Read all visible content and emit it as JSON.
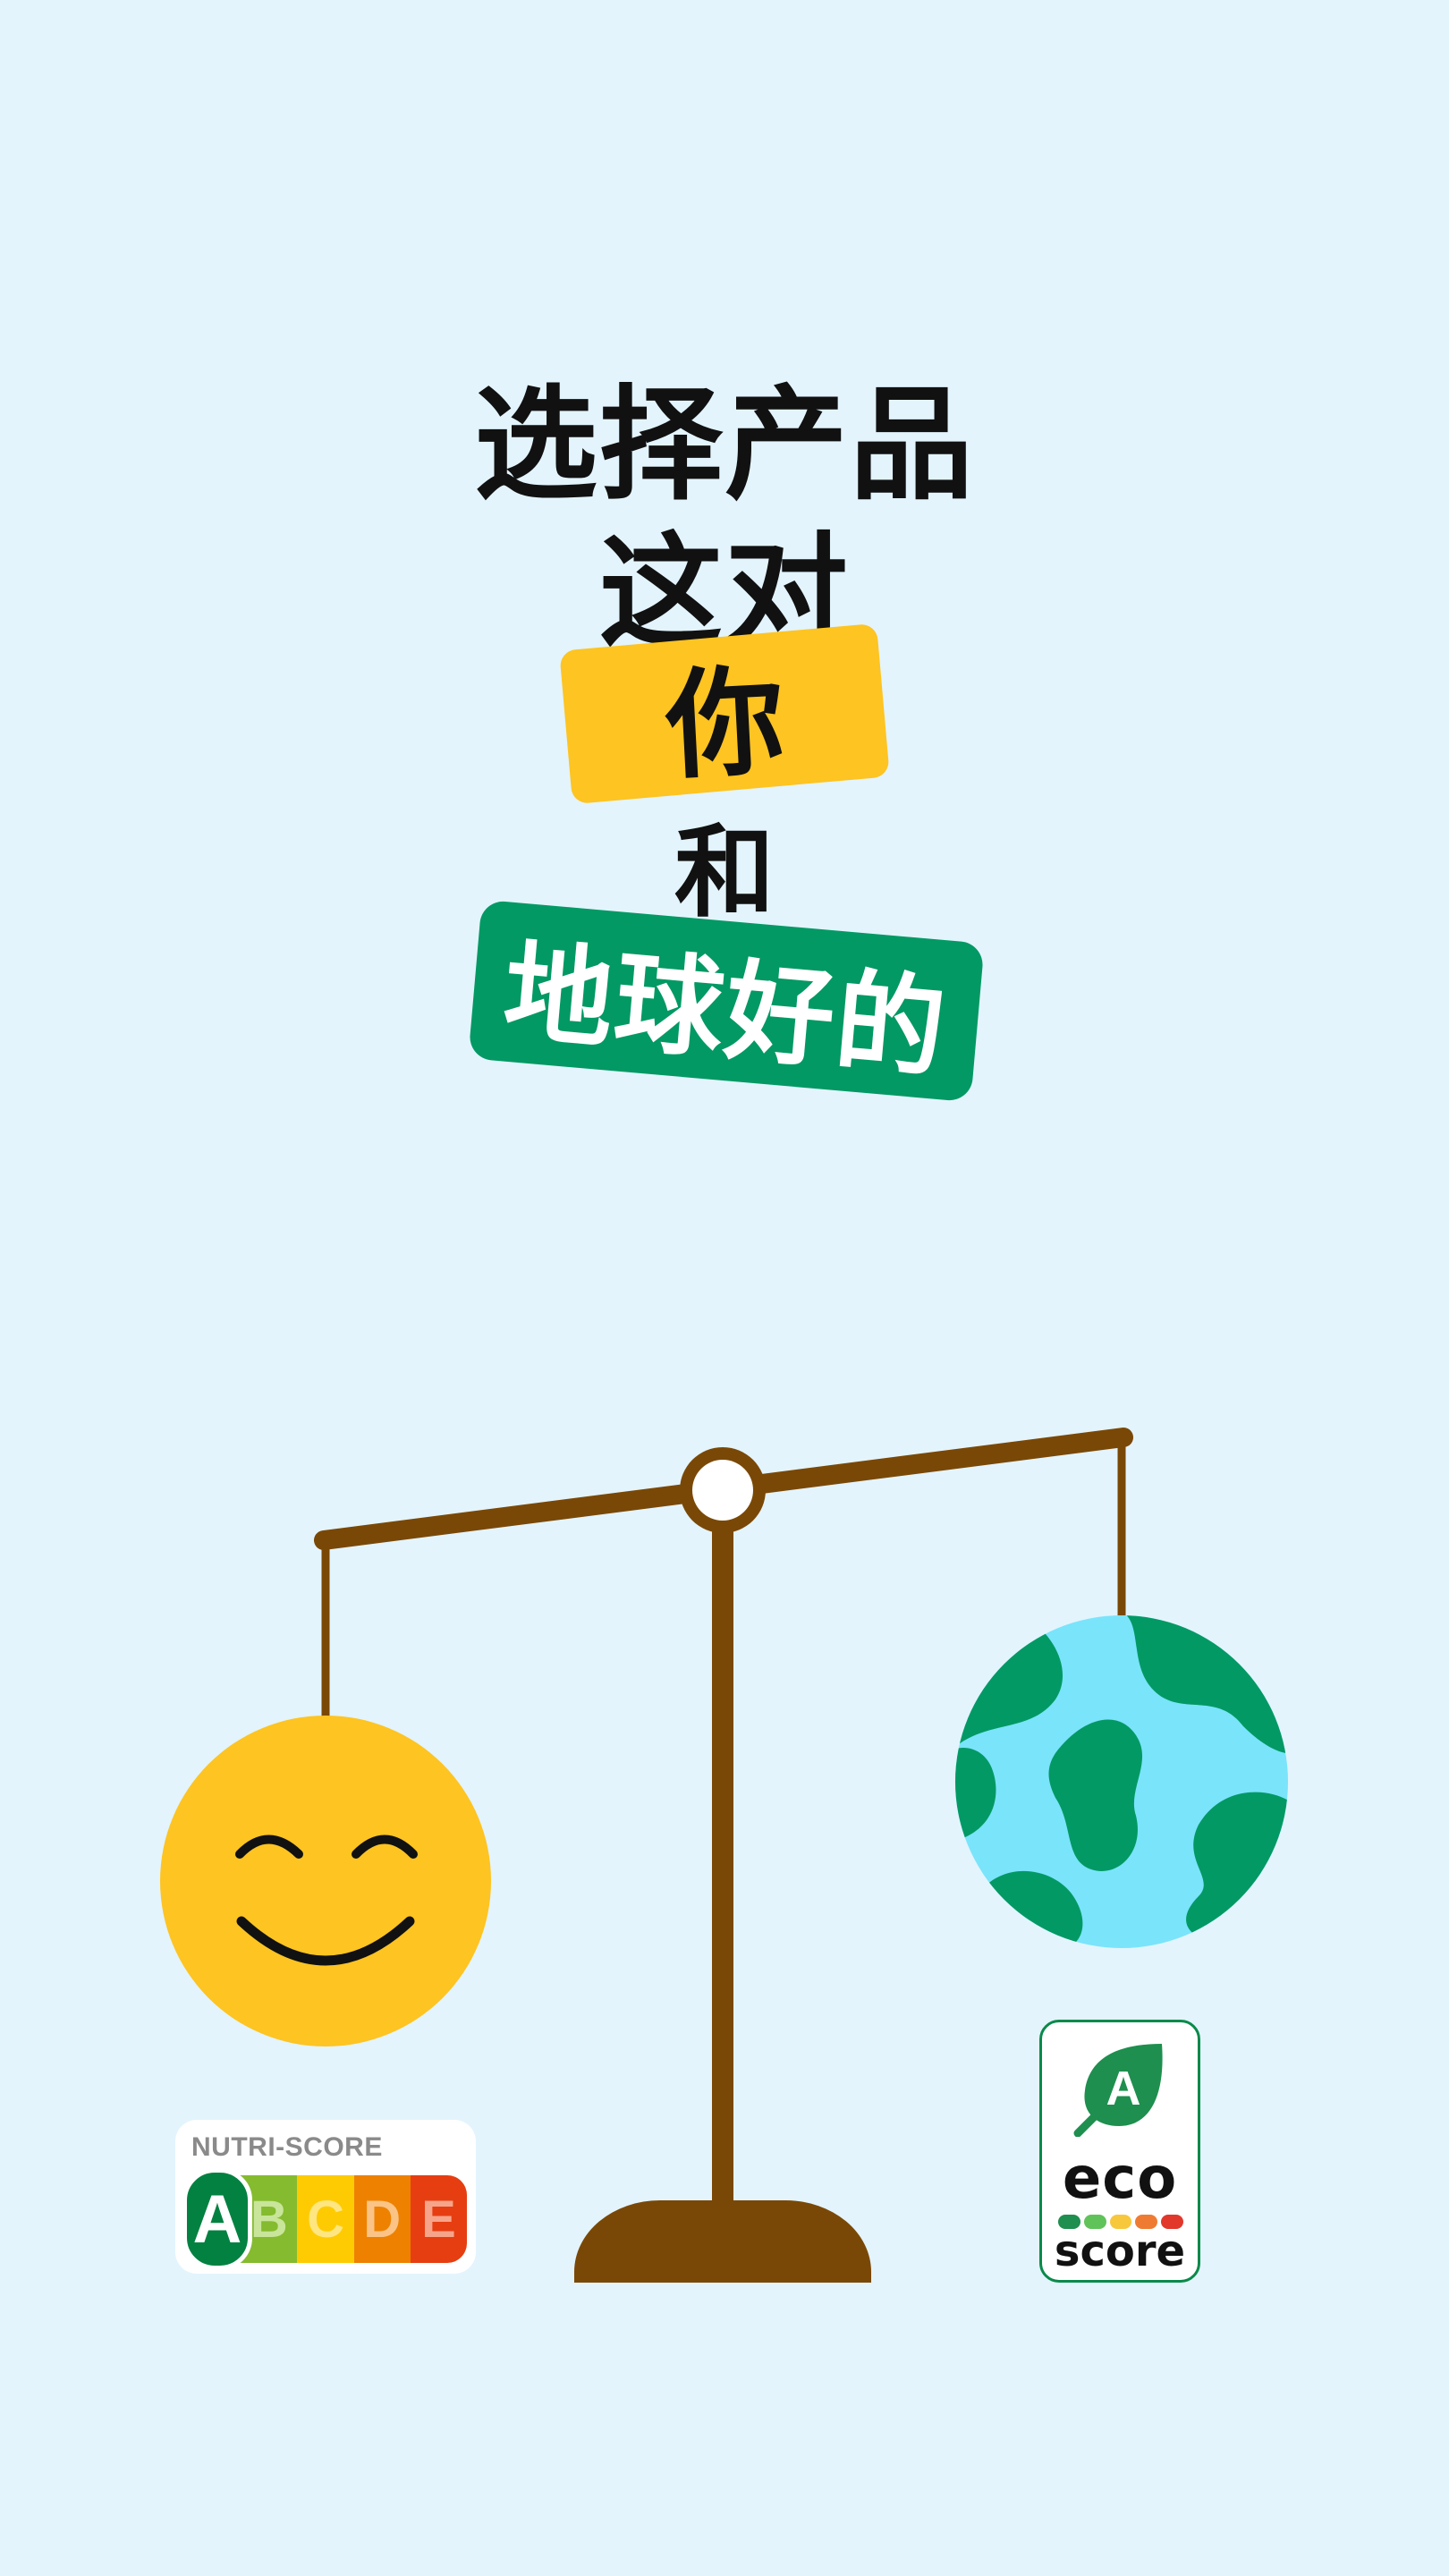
{
  "headline": {
    "line1": "选择产品",
    "line2": "这对",
    "highlight_you": "你",
    "line3": "和",
    "highlight_planet": "地球好的"
  },
  "nutri_score": {
    "title": "NUTRI-SCORE",
    "grades": [
      {
        "letter": "A",
        "color": "#038141",
        "text_color": "#ffffff",
        "selected": true
      },
      {
        "letter": "B",
        "color": "#85bb2f",
        "text_color": "#c8e59a",
        "selected": false
      },
      {
        "letter": "C",
        "color": "#fecb02",
        "text_color": "#ffe680",
        "selected": false
      },
      {
        "letter": "D",
        "color": "#ee8100",
        "text_color": "#fbc486",
        "selected": false
      },
      {
        "letter": "E",
        "color": "#e63e11",
        "text_color": "#f7a58a",
        "selected": false
      }
    ]
  },
  "eco_score": {
    "grade": "A",
    "line1": "eco",
    "line2": "score",
    "dot_colors": [
      "#1e8f4e",
      "#60c35a",
      "#f8c83c",
      "#ef7b32",
      "#e1382b"
    ]
  },
  "colors": {
    "background": "#e3f4fd",
    "yellow": "#fdc422",
    "green": "#039964",
    "brown": "#7a4806",
    "ocean": "#7ae4fb"
  }
}
